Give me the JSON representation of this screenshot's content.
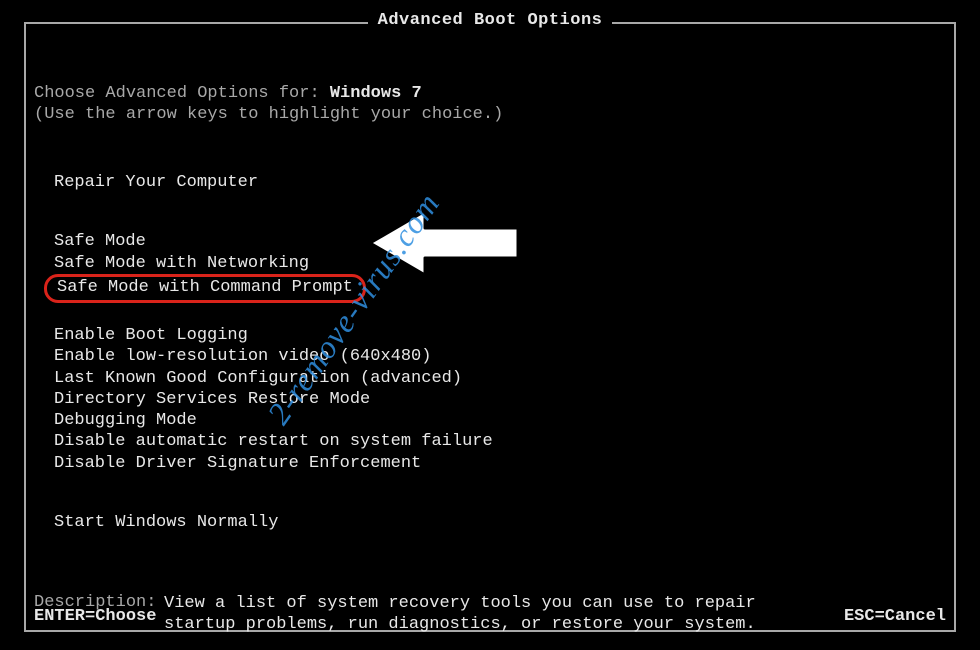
{
  "title": "Advanced Boot Options",
  "prompt": {
    "prefix": "Choose Advanced Options for: ",
    "os": "Windows 7",
    "hint": "(Use the arrow keys to highlight your choice.)"
  },
  "groups": {
    "repair": [
      "Repair Your Computer"
    ],
    "safe": [
      "Safe Mode",
      "Safe Mode with Networking",
      "Safe Mode with Command Prompt"
    ],
    "advanced": [
      "Enable Boot Logging",
      "Enable low-resolution video (640x480)",
      "Last Known Good Configuration (advanced)",
      "Directory Services Restore Mode",
      "Debugging Mode",
      "Disable automatic restart on system failure",
      "Disable Driver Signature Enforcement"
    ],
    "normal": [
      "Start Windows Normally"
    ]
  },
  "highlighted_index": 2,
  "description": {
    "label": "Description:",
    "text": "View a list of system recovery tools you can use to repair startup problems, run diagnostics, or restore your system."
  },
  "footer": {
    "left": "ENTER=Choose",
    "right": "ESC=Cancel"
  },
  "watermark": "2-remove-virus.com",
  "icons": {
    "pointer_arrow": "pointer-arrow-icon"
  }
}
